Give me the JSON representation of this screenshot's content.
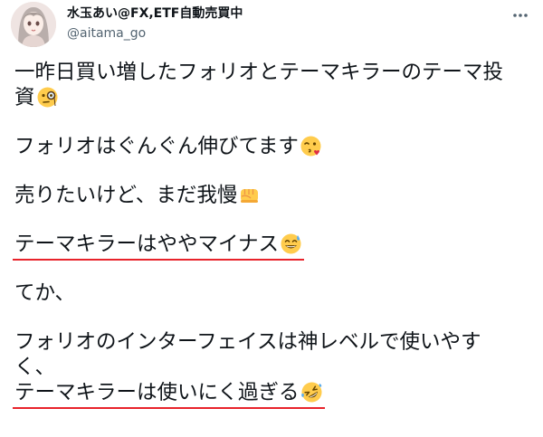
{
  "author": {
    "display_name": "水玉あい@FX,ETF自動売買中",
    "handle": "@aitama_go"
  },
  "icons": {
    "avatar": "anime-girl-avatar",
    "more": "more-dots-icon",
    "monocle": "face-with-monocle-emoji",
    "kiss": "face-blowing-kiss-emoji",
    "fist": "oncoming-fist-emoji",
    "sweat": "grinning-face-with-sweat-emoji",
    "rofl": "rolling-on-floor-laughing-emoji"
  },
  "colors": {
    "underline": "#e8232b",
    "text": "#0f1419",
    "secondary": "#536471"
  },
  "tweet": {
    "line1": "一昨日買い増したフォリオとテーマキラーのテーマ投",
    "line2": "資",
    "line3": "フォリオはぐんぐん伸びてます",
    "line4": "売りたいけど、まだ我慢",
    "line5": "テーマキラーはややマイナス",
    "line6": "てか、",
    "line7": "フォリオのインターフェイスは神レベルで使いやす",
    "line8": "く、",
    "line9": "テーマキラーは使いにく過ぎる"
  }
}
